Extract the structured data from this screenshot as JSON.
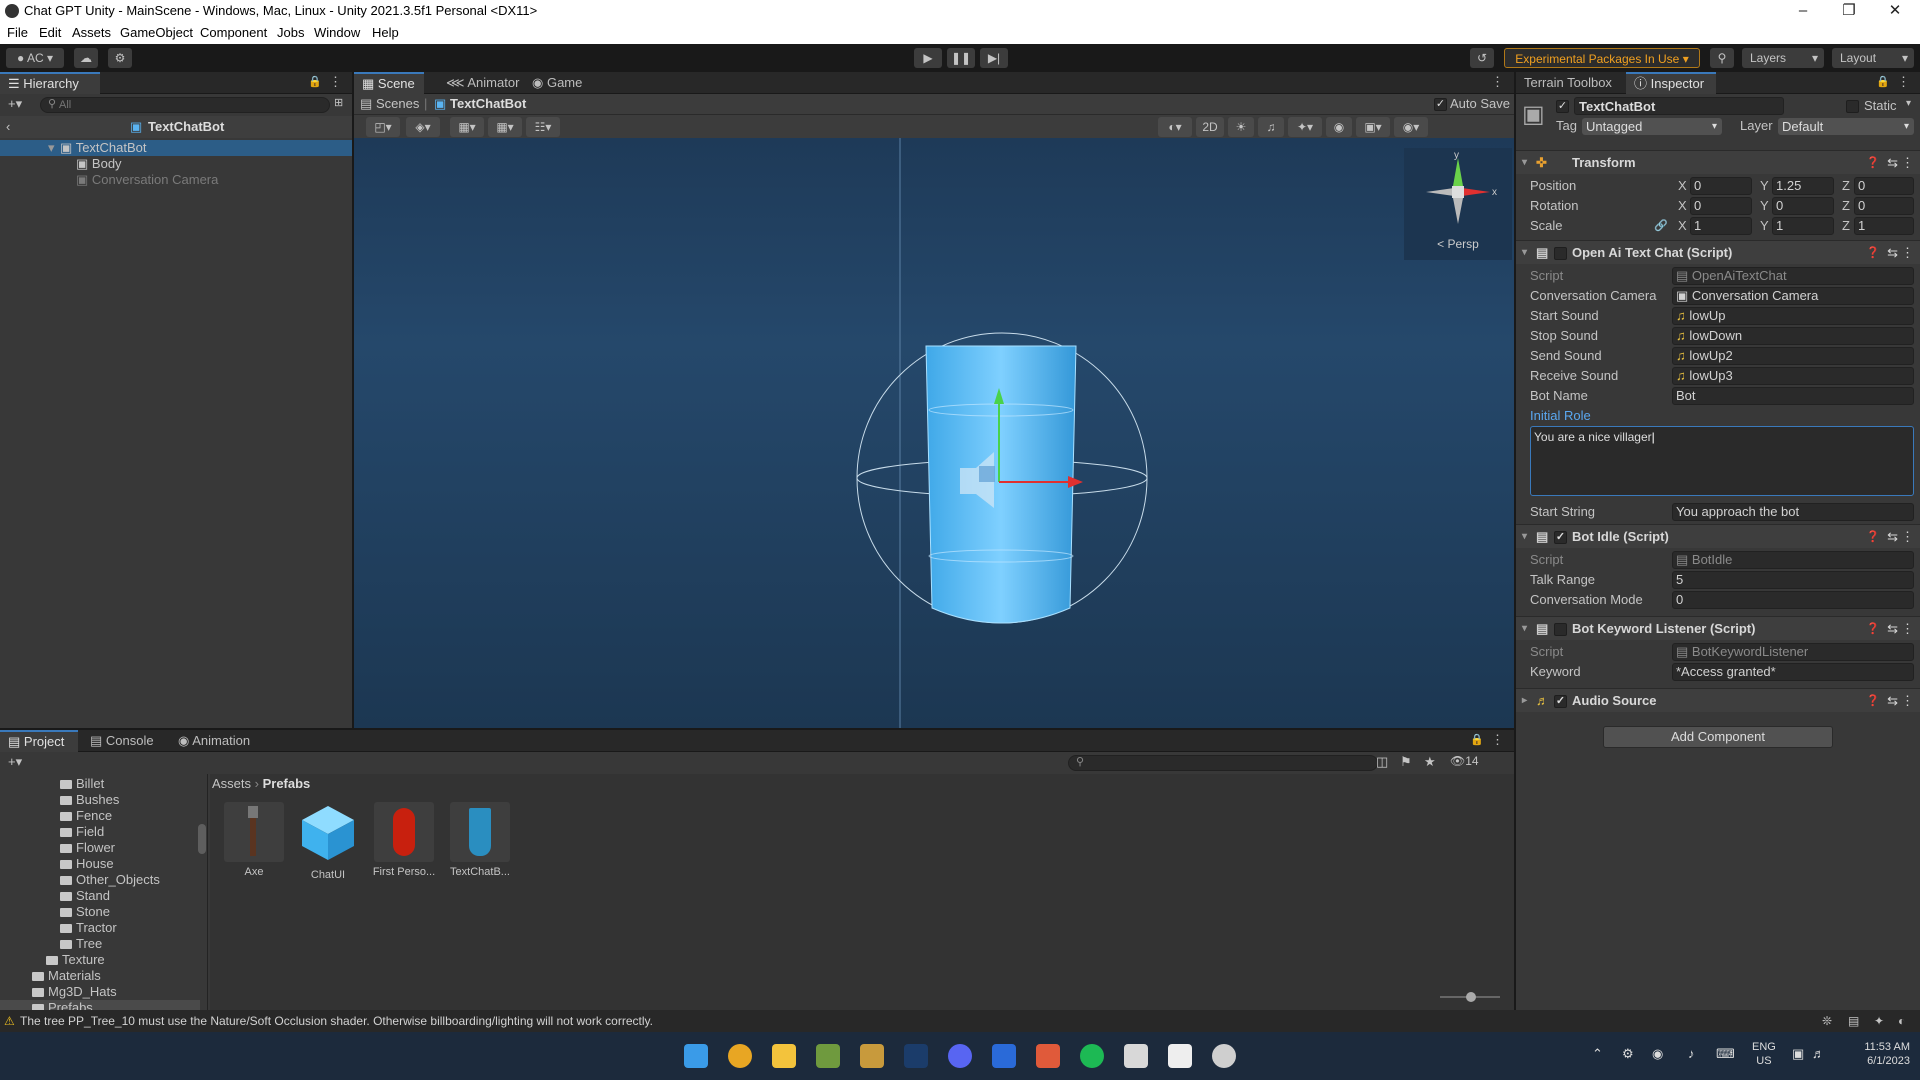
{
  "window": {
    "title": "Chat GPT Unity - MainScene - Windows, Mac, Linux - Unity 2021.3.5f1 Personal <DX11>"
  },
  "menu": [
    "File",
    "Edit",
    "Assets",
    "GameObject",
    "Component",
    "Jobs",
    "Window",
    "Help"
  ],
  "toolbar": {
    "account": "AC",
    "experimental": "Experimental Packages In Use",
    "layers": "Layers",
    "layout": "Layout"
  },
  "hierarchy": {
    "tab": "Hierarchy",
    "search_placeholder": "All",
    "scene": "TextChatBot",
    "items": [
      "TextChatBot",
      "Body",
      "Conversation Camera"
    ]
  },
  "scene_tabs": [
    "Scene",
    "Animator",
    "Game"
  ],
  "scene_breadcrumb": {
    "root": "Scenes",
    "current": "TextChatBot",
    "autosave": "Auto Save"
  },
  "scene_view": {
    "mode_2d": "2D",
    "persp": "< Persp",
    "axis_y": "y",
    "axis_x": "x"
  },
  "inspector": {
    "tabs": [
      "Terrain Toolbox",
      "Inspector"
    ],
    "object_name": "TextChatBot",
    "static": "Static",
    "tag_label": "Tag",
    "tag": "Untagged",
    "layer_label": "Layer",
    "layer": "Default",
    "transform": {
      "title": "Transform",
      "rows": [
        {
          "label": "Position",
          "x": "0",
          "y": "1.25",
          "z": "0"
        },
        {
          "label": "Rotation",
          "x": "0",
          "y": "0",
          "z": "0"
        },
        {
          "label": "Scale",
          "x": "1",
          "y": "1",
          "z": "1"
        }
      ]
    },
    "openai": {
      "title": "Open Ai Text Chat (Script)",
      "fields": [
        {
          "label": "Script",
          "value": "OpenAiTextChat"
        },
        {
          "label": "Conversation Camera",
          "value": "Conversation Camera"
        },
        {
          "label": "Start Sound",
          "value": "lowUp"
        },
        {
          "label": "Stop Sound",
          "value": "lowDown"
        },
        {
          "label": "Send Sound",
          "value": "lowUp2"
        },
        {
          "label": "Receive Sound",
          "value": "lowUp3"
        },
        {
          "label": "Bot Name",
          "value": "Bot"
        }
      ],
      "initial_role_label": "Initial Role",
      "initial_role": "You are a nice villager",
      "start_string_label": "Start String",
      "start_string": "You approach the bot"
    },
    "botidle": {
      "title": "Bot Idle (Script)",
      "fields": [
        {
          "label": "Script",
          "value": "BotIdle"
        },
        {
          "label": "Talk Range",
          "value": "5"
        },
        {
          "label": "Conversation Mode",
          "value": "0"
        }
      ]
    },
    "keyword": {
      "title": "Bot Keyword Listener (Script)",
      "fields": [
        {
          "label": "Script",
          "value": "BotKeywordListener"
        },
        {
          "label": "Keyword",
          "value": "*Access granted*"
        }
      ]
    },
    "audio": {
      "title": "Audio Source"
    },
    "add_component": "Add Component"
  },
  "project": {
    "tabs": [
      "Project",
      "Console",
      "Animation"
    ],
    "folders": [
      "Billet",
      "Bushes",
      "Fence",
      "Field",
      "Flower",
      "House",
      "Other_Objects",
      "Stand",
      "Stone",
      "Tractor",
      "Tree",
      "Texture",
      "Materials",
      "Mg3D_Hats",
      "Prefabs"
    ],
    "breadcrumb": [
      "Assets",
      "Prefabs"
    ],
    "assets": [
      "Axe",
      "ChatUI",
      "First Perso...",
      "TextChatB..."
    ],
    "hidden_count": "14"
  },
  "status": {
    "warning": "The tree PP_Tree_10 must use the Nature/Soft Occlusion shader. Otherwise billboarding/lighting will not work correctly."
  },
  "taskbar": {
    "lang": "ENG",
    "region": "US",
    "time": "11:53 AM",
    "date": "6/1/2023"
  }
}
